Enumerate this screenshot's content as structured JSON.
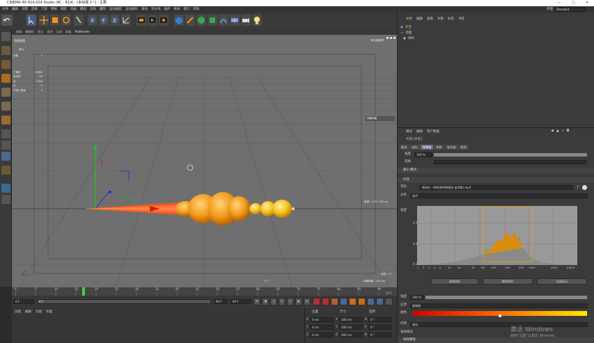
{
  "app": {
    "title": "CINEMA 4D R19.024 Studio (RC - R19) - [未标题 2 *] - 主要",
    "controls": [
      "—",
      "□",
      "✕"
    ]
  },
  "menu": [
    "文件",
    "编辑",
    "创建",
    "选择",
    "工具",
    "网格",
    "捕捉",
    "动画",
    "模拟",
    "渲染",
    "雕刻",
    "运动跟踪",
    "运动图形",
    "角色",
    "流水线",
    "插件",
    "脚本",
    "窗口",
    "帮助"
  ],
  "layout": {
    "label": "界面",
    "value": "Standard"
  },
  "viewport": {
    "tabs": [
      "查看",
      "摄像机",
      "显示",
      "选项",
      "过滤",
      "面板",
      "ProRender"
    ],
    "label": "透视视图",
    "stats_label": "统计",
    "stats": [
      {
        "k": "对象",
        "v": "2"
      },
      {
        "k": "三角形",
        "v": "17682"
      },
      {
        "k": "多边形",
        "v": "16"
      },
      {
        "k": "点",
        "v": "7104"
      },
      {
        "k": "边",
        "v": "0"
      },
      {
        "k": "可视三角面",
        "v": "0"
      }
    ],
    "right_label": "默认摄像机",
    "grid_spacing_label": "网格间距",
    "grid_spacing_value": "1000 cm",
    "grid_spacing_bottom": "网格间距：100 cm",
    "fps_right": "帧数 : 17",
    "dist_label": "距离：1371.446 cm",
    "frame_mid": "17 F"
  },
  "timeline": {
    "ticks": [
      "0",
      "5",
      "10",
      "15",
      "20",
      "25",
      "30",
      "35",
      "40",
      "45",
      "50",
      "55",
      "60",
      "65",
      "70",
      "75",
      "80",
      "85",
      "90"
    ],
    "current": "17 F"
  },
  "playback": {
    "start": "0 F",
    "start2": "0 F",
    "end": "90 F",
    "end2": "90 F"
  },
  "material": {
    "tabs": [
      "创建",
      "编辑",
      "功能",
      "纹理"
    ]
  },
  "coords": {
    "headers": [
      "位置",
      "尺寸",
      "旋转"
    ],
    "rows": [
      {
        "a": "X",
        "pos": "0 cm",
        "b": "X",
        "size": "200 cm",
        "c": "H",
        "rot": "0 °"
      },
      {
        "a": "Y",
        "pos": "0 cm",
        "b": "Y",
        "size": "200 cm",
        "c": "P",
        "rot": "0 °"
      },
      {
        "a": "Z",
        "pos": "0 cm",
        "b": "Z",
        "size": "200 cm",
        "c": "B",
        "rot": "0 °"
      }
    ]
  },
  "objects": {
    "tabs": [
      "文件",
      "编辑",
      "查看",
      "对象",
      "标签",
      "书签"
    ],
    "items": [
      "声音",
      "地面",
      "球体"
    ]
  },
  "attributes": {
    "tabs": [
      "模式",
      "编辑",
      "用户数据"
    ],
    "header": "声音 [声音]",
    "subtabs": [
      "基本",
      "坐标",
      "效果器",
      "参数",
      "变形器",
      "衰减"
    ],
    "active_subtab": "效果器",
    "strength_label": "强度",
    "strength_value": "100 %",
    "selection_label": "选择",
    "sections": [
      "最小/最大",
      "声音"
    ],
    "sound_label": "音轨",
    "sound_file": "周杰伦 - BINGBIAN(周杰 女声版).mp3",
    "distribution_label": "分布",
    "distribution_value": "迭代",
    "graph_label": "强度",
    "y_ticks": [
      "0.7",
      "0.4",
      "0.1"
    ],
    "x_ticks": [
      "1",
      "2",
      "3",
      "4",
      "5",
      "10",
      "20",
      "40",
      "60",
      "100",
      "200",
      "500",
      "1000",
      "4000",
      "10000"
    ],
    "buttons": [
      "添加探针",
      "移除探针",
      "全部显示"
    ],
    "amp_label": "强度",
    "amp_value": "100 %",
    "apply_label": "应用",
    "apply_value": "复制调",
    "color_label": "颜色",
    "color_mode_label": "作用",
    "color_mode_value": "强化",
    "more_label": "采样模式",
    "section3": "采样属性"
  },
  "watermark": {
    "title": "激活 Windows",
    "sub": "转到\"设置\"以激活 Windows。"
  },
  "colors": {
    "accent": "#f7941d",
    "highlight": "#ff6a00",
    "gradient_start": "#d40000",
    "gradient_end": "#ffe600"
  }
}
